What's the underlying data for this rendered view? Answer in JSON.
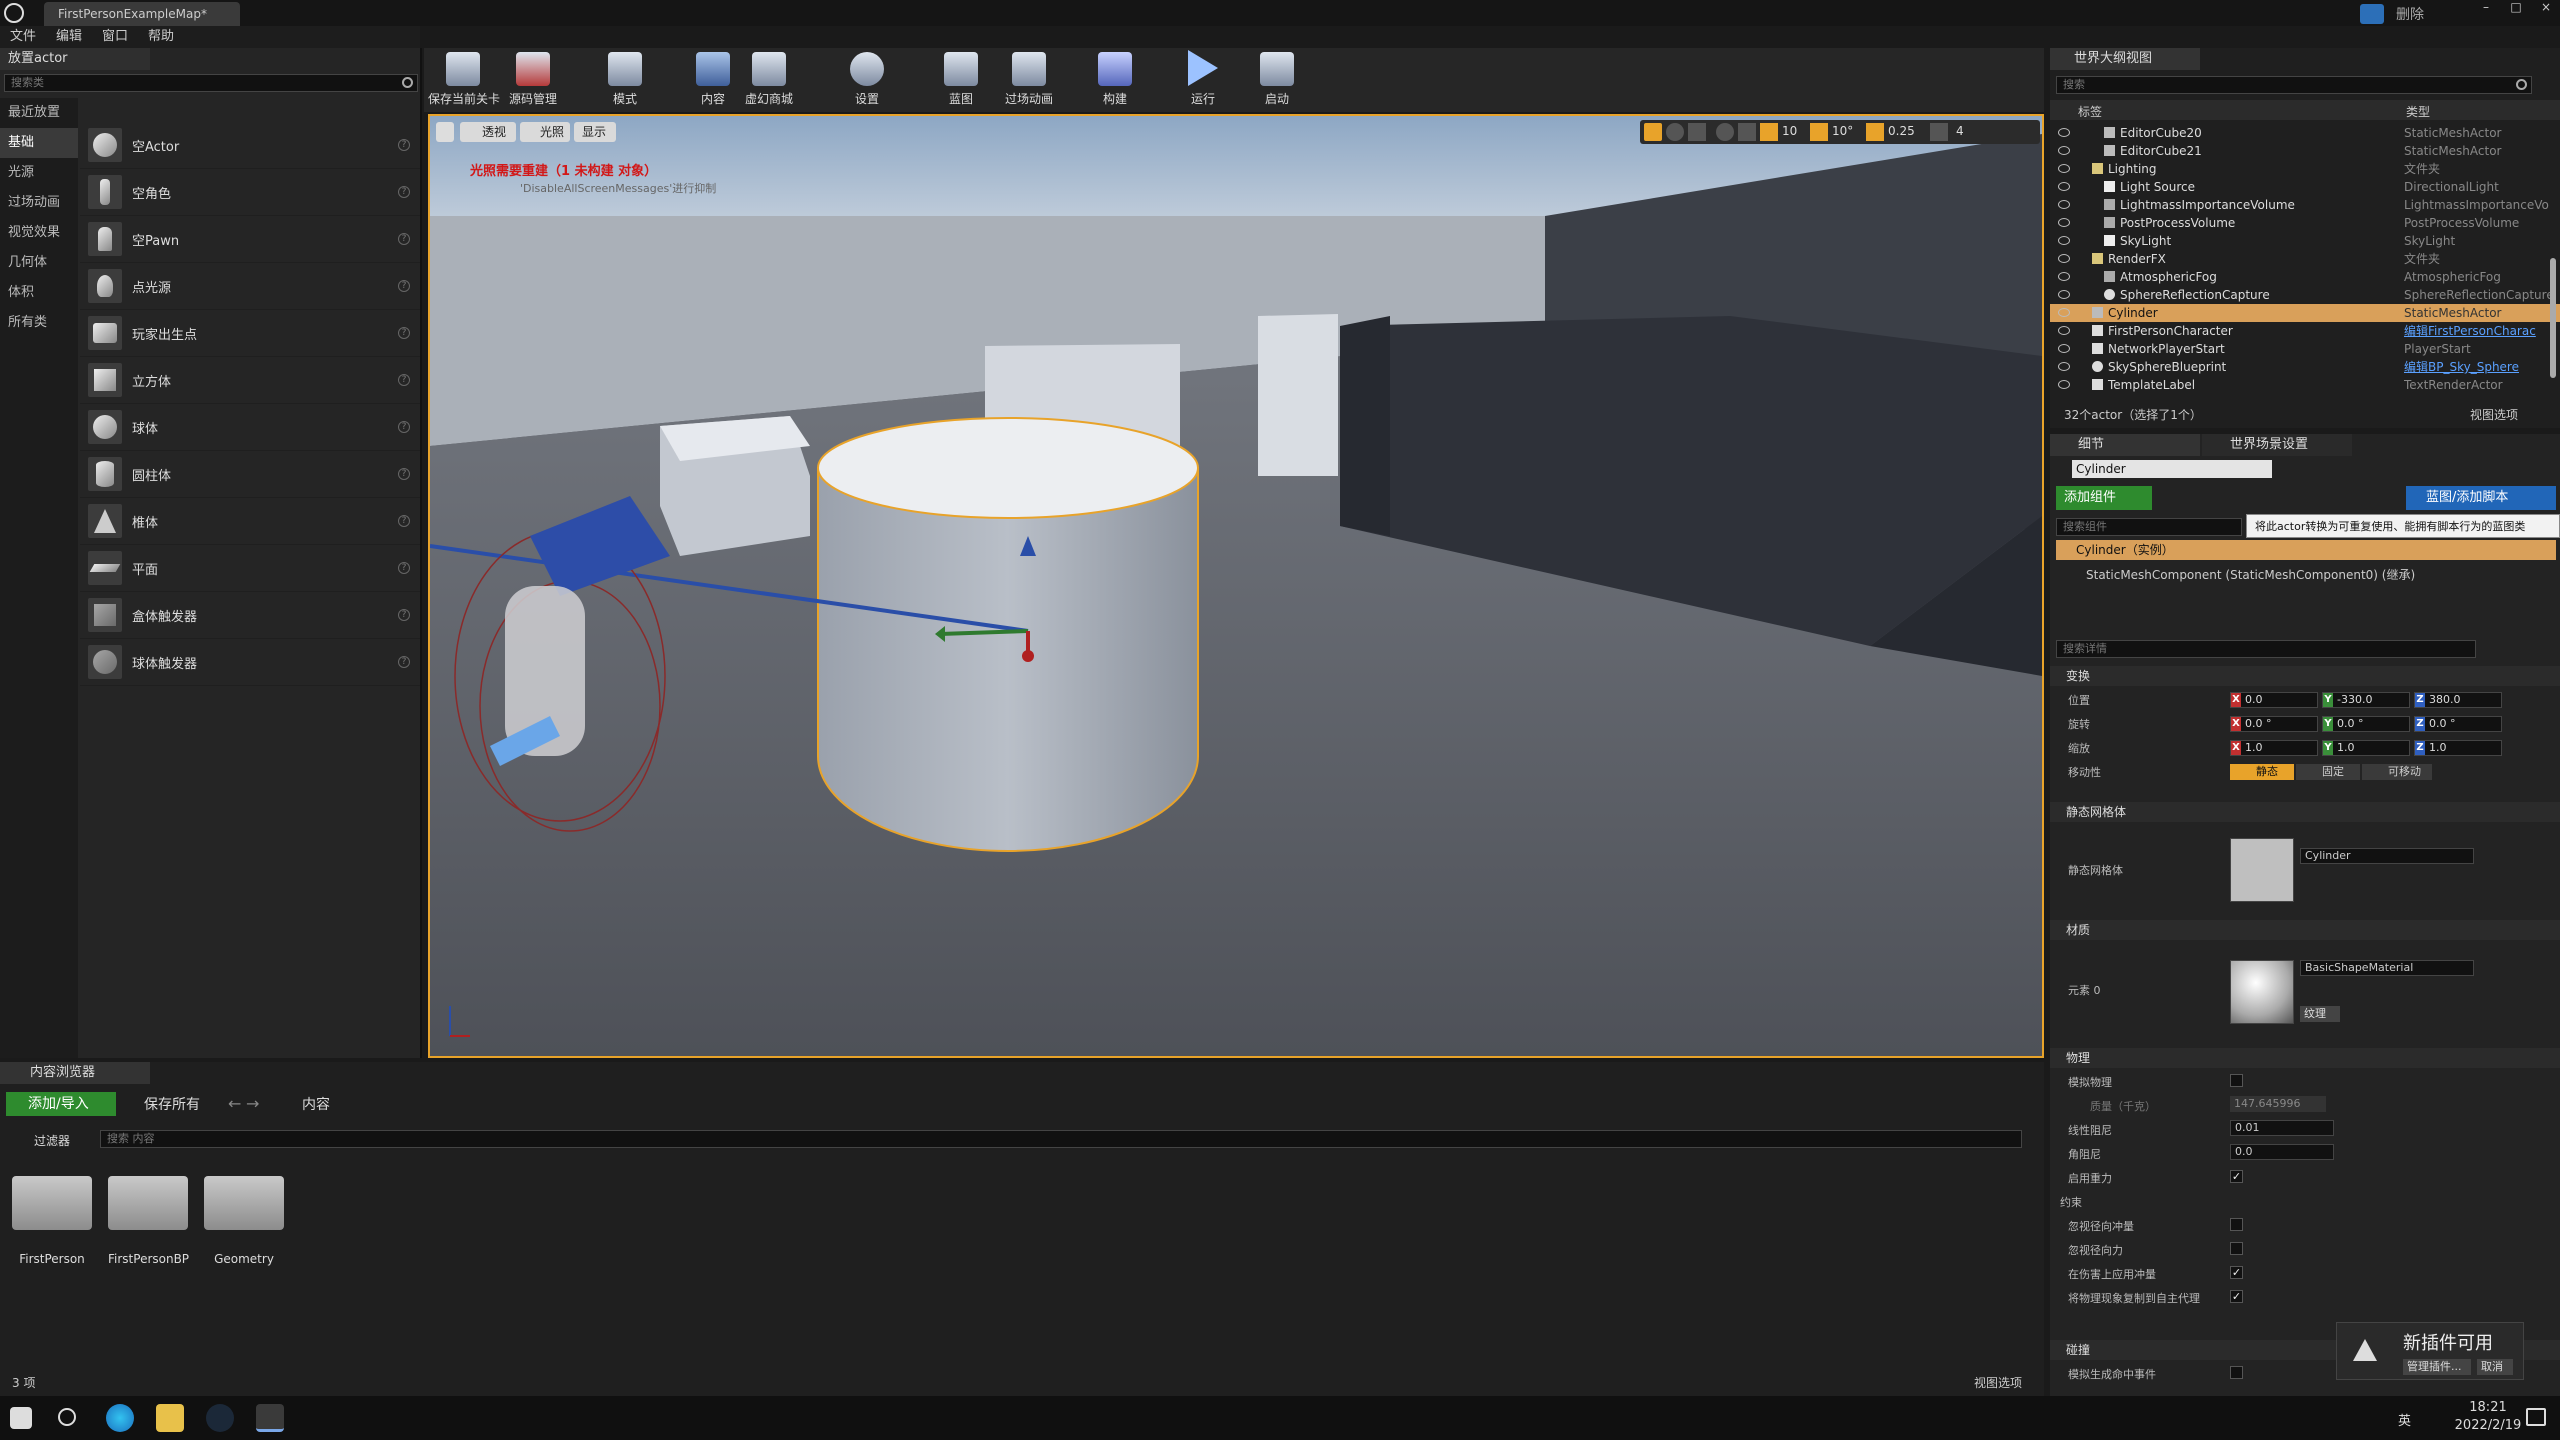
{
  "window": {
    "title": "FirstPersonExampleMap*",
    "delete_label": "删除"
  },
  "menu": [
    "文件",
    "编辑",
    "窗口",
    "帮助"
  ],
  "place_actor": {
    "tab": "放置actor",
    "search_placeholder": "搜索类",
    "categories": [
      "最近放置",
      "基础",
      "光源",
      "过场动画",
      "视觉效果",
      "几何体",
      "体积",
      "所有类"
    ],
    "items": [
      "空Actor",
      "空角色",
      "空Pawn",
      "点光源",
      "玩家出生点",
      "立方体",
      "球体",
      "圆柱体",
      "椎体",
      "平面",
      "盒体触发器",
      "球体触发器"
    ]
  },
  "toolbar": [
    "保存当前关卡",
    "源码管理",
    "模式",
    "内容",
    "虚幻商城",
    "设置",
    "蓝图",
    "过场动画",
    "构建",
    "运行",
    "启动"
  ],
  "viewport": {
    "view_buttons": [
      "透视",
      "光照",
      "显示"
    ],
    "warning": "光照需要重建（1 未构建 对象）",
    "warning_sub": "'DisableAllScreenMessages'进行抑制",
    "snap": {
      "grid": "10",
      "rotation": "10°",
      "scale": "0.25",
      "camera_speed": "4"
    }
  },
  "outliner": {
    "tab": "世界大纲视图",
    "search_placeholder": "搜索",
    "col_label": "标签",
    "col_type": "类型",
    "rows": [
      {
        "name": "EditorCube20",
        "type": "StaticMeshActor",
        "indent": 2,
        "kind": "mesh"
      },
      {
        "name": "EditorCube21",
        "type": "StaticMeshActor",
        "indent": 2,
        "kind": "mesh"
      },
      {
        "name": "Lighting",
        "type": "文件夹",
        "indent": 1,
        "kind": "folder"
      },
      {
        "name": "Light Source",
        "type": "DirectionalLight",
        "indent": 2,
        "kind": "light"
      },
      {
        "name": "LightmassImportanceVolume",
        "type": "LightmassImportanceVo",
        "indent": 2,
        "kind": "vol"
      },
      {
        "name": "PostProcessVolume",
        "type": "PostProcessVolume",
        "indent": 2,
        "kind": "vol"
      },
      {
        "name": "SkyLight",
        "type": "SkyLight",
        "indent": 2,
        "kind": "light"
      },
      {
        "name": "RenderFX",
        "type": "文件夹",
        "indent": 1,
        "kind": "folder"
      },
      {
        "name": "AtmosphericFog",
        "type": "AtmosphericFog",
        "indent": 2,
        "kind": "fog"
      },
      {
        "name": "SphereReflectionCapture",
        "type": "SphereReflectionCapture",
        "indent": 2,
        "kind": "sphere"
      },
      {
        "name": "Cylinder",
        "type": "StaticMeshActor",
        "indent": 1,
        "kind": "mesh",
        "selected": true
      },
      {
        "name": "FirstPersonCharacter",
        "type": "编辑FirstPersonCharac",
        "indent": 1,
        "kind": "pawn",
        "link": true
      },
      {
        "name": "NetworkPlayerStart",
        "type": "PlayerStart",
        "indent": 1,
        "kind": "start"
      },
      {
        "name": "SkySphereBlueprint",
        "type": "编辑BP_Sky_Sphere",
        "indent": 1,
        "kind": "sphere",
        "link": true
      },
      {
        "name": "TemplateLabel",
        "type": "TextRenderActor",
        "indent": 1,
        "kind": "text"
      }
    ],
    "count": "32个actor（选择了1个）",
    "view_options": "视图选项"
  },
  "details": {
    "tabs": [
      "细节",
      "世界场景设置"
    ],
    "actor_name": "Cylinder",
    "add_component": "添加组件",
    "blueprint_btn": "蓝图/添加脚本",
    "tooltip": "将此actor转换为可重复使用、能拥有脚本行为的蓝图类",
    "search_components": "搜索组件",
    "instance": "Cylinder（实例）",
    "component": "StaticMeshComponent (StaticMeshComponent0) (继承)",
    "search_details": "搜索详情",
    "transform": {
      "section": "变换",
      "location_label": "位置",
      "location": [
        "0.0",
        "-330.0",
        "380.0"
      ],
      "rotation_label": "旋转",
      "rotation": [
        "0.0 °",
        "0.0 °",
        "0.0 °"
      ],
      "scale_label": "缩放",
      "scale": [
        "1.0",
        "1.0",
        "1.0"
      ],
      "mobility_label": "移动性",
      "mobility": [
        "静态",
        "固定",
        "可移动"
      ]
    },
    "static_mesh": {
      "section": "静态网格体",
      "label": "静态网格体",
      "value": "Cylinder"
    },
    "materials": {
      "section": "材质",
      "label": "元素 0",
      "value": "BasicShapeMaterial",
      "texture": "纹理"
    },
    "physics": {
      "section": "物理",
      "simulate": "模拟物理",
      "mass_label": "质量（千克）",
      "mass": "147.645996",
      "linear_damping_label": "线性阻尼",
      "linear_damping": "0.01",
      "angular_damping_label": "角阻尼",
      "angular_damping": "0.0",
      "gravity": "启用重力",
      "constraints": "约束",
      "ignore_radial_impulse": "忽视径向冲量",
      "ignore_radial_force": "忽视径向力",
      "apply_impulse": "在伤害上应用冲量",
      "replicate_physics": "将物理现象复制到自主代理"
    },
    "collision": {
      "section": "碰撞",
      "generate_overlap": "模拟生成命中事件"
    }
  },
  "plugin_notice": {
    "title": "新插件可用",
    "manage": "管理插件...",
    "cancel": "取消"
  },
  "content_browser": {
    "tab": "内容浏览器",
    "add_import": "添加/导入",
    "save_all": "保存所有",
    "path": "内容",
    "filters": "过滤器",
    "search_placeholder": "搜索 内容",
    "folders": [
      "FirstPerson",
      "FirstPersonBP",
      "Geometry"
    ],
    "item_count": "3 项",
    "view_options": "视图选项"
  },
  "taskbar": {
    "time": "18:21",
    "date": "2022/2/19",
    "ime": "英"
  },
  "colors": {
    "accent": "#e8a32a",
    "selected_row": "#d9a05a",
    "green_btn": "#2e8b2e",
    "blue_btn": "#2166b8"
  }
}
